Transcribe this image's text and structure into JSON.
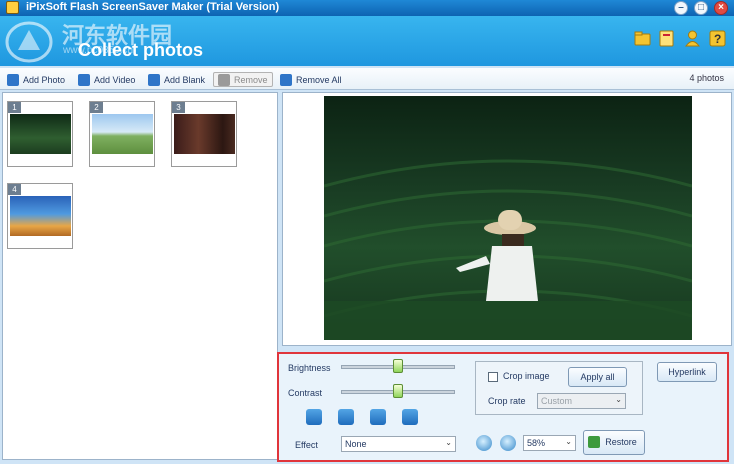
{
  "window": {
    "title": "iPixSoft Flash ScreenSaver Maker (Trial Version)"
  },
  "header": {
    "watermark": "河东软件园",
    "watermark_url": "www.pc0359.cn",
    "section_title": "Collect photos"
  },
  "toolbar": {
    "add_photo": "Add Photo",
    "add_video": "Add Video",
    "add_blank": "Add Blank",
    "remove": "Remove",
    "remove_all": "Remove All",
    "photo_count": "4 photos"
  },
  "thumbnails": [
    {
      "num": "1",
      "theme": "green-field"
    },
    {
      "num": "2",
      "theme": "sky-landscape"
    },
    {
      "num": "3",
      "theme": "movie-poster"
    },
    {
      "num": "4",
      "theme": "game-poster"
    }
  ],
  "controls": {
    "brightness_label": "Brightness",
    "brightness_level": 0.5,
    "contrast_label": "Contrast",
    "contrast_level": 0.5,
    "crop_image_label": "Crop image",
    "crop_checked": false,
    "apply_all_label": "Apply all",
    "crop_rate_label": "Crop rate",
    "crop_rate_value": "Custom",
    "hyperlink_label": "Hyperlink",
    "effect_label": "Effect",
    "effect_value": "None",
    "zoom_value": "58%",
    "restore_label": "Restore"
  },
  "colors": {
    "accent": "#1f97df",
    "highlight_border": "#e0353b"
  }
}
